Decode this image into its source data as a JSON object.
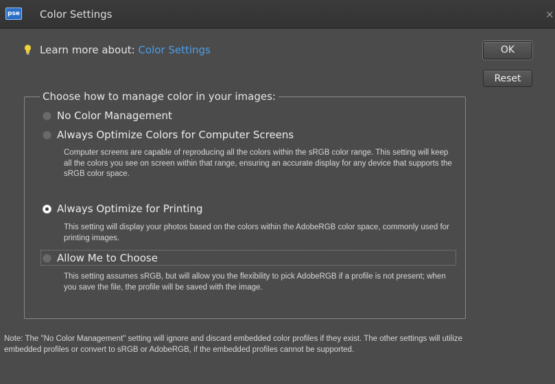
{
  "window": {
    "title": "Color Settings",
    "app_icon_text": "pse",
    "close_glyph": "×"
  },
  "learn_more": {
    "prefix": "Learn more about:",
    "link_text": "Color Settings",
    "icon": "lightbulb-icon"
  },
  "buttons": {
    "ok": "OK",
    "reset": "Reset"
  },
  "group": {
    "legend": "Choose how to manage color in your images:",
    "selected": "always-optimize-printing",
    "options": [
      {
        "id": "no-color-management",
        "label": "No Color Management",
        "checked": false,
        "description": ""
      },
      {
        "id": "always-optimize-screens",
        "label": "Always Optimize Colors for Computer Screens",
        "checked": false,
        "description": "Computer screens are capable of reproducing all the colors within the sRGB color range. This setting will keep all the colors you see on screen within that range, ensuring an accurate display for any device that supports the sRGB color space."
      },
      {
        "id": "always-optimize-printing",
        "label": "Always Optimize for Printing",
        "checked": true,
        "description": "This setting will display your photos based on the colors within the AdobeRGB color space, commonly used for printing images."
      },
      {
        "id": "allow-me-to-choose",
        "label": "Allow Me to Choose",
        "checked": false,
        "description": "This setting assumes sRGB, but will allow you the flexibility to pick AdobeRGB if a profile is not present; when you save the file, the profile will be saved with the image."
      }
    ]
  },
  "note": "Note: The \"No Color Management\" setting will ignore and discard embedded color profiles if they exist. The other settings will utilize embedded profiles or convert to sRGB or AdobeRGB, if the embedded profiles cannot be supported.",
  "colors": {
    "dialog_bg": "#4b4b4b",
    "link": "#4a9ee8",
    "text": "#e6e6e6"
  }
}
